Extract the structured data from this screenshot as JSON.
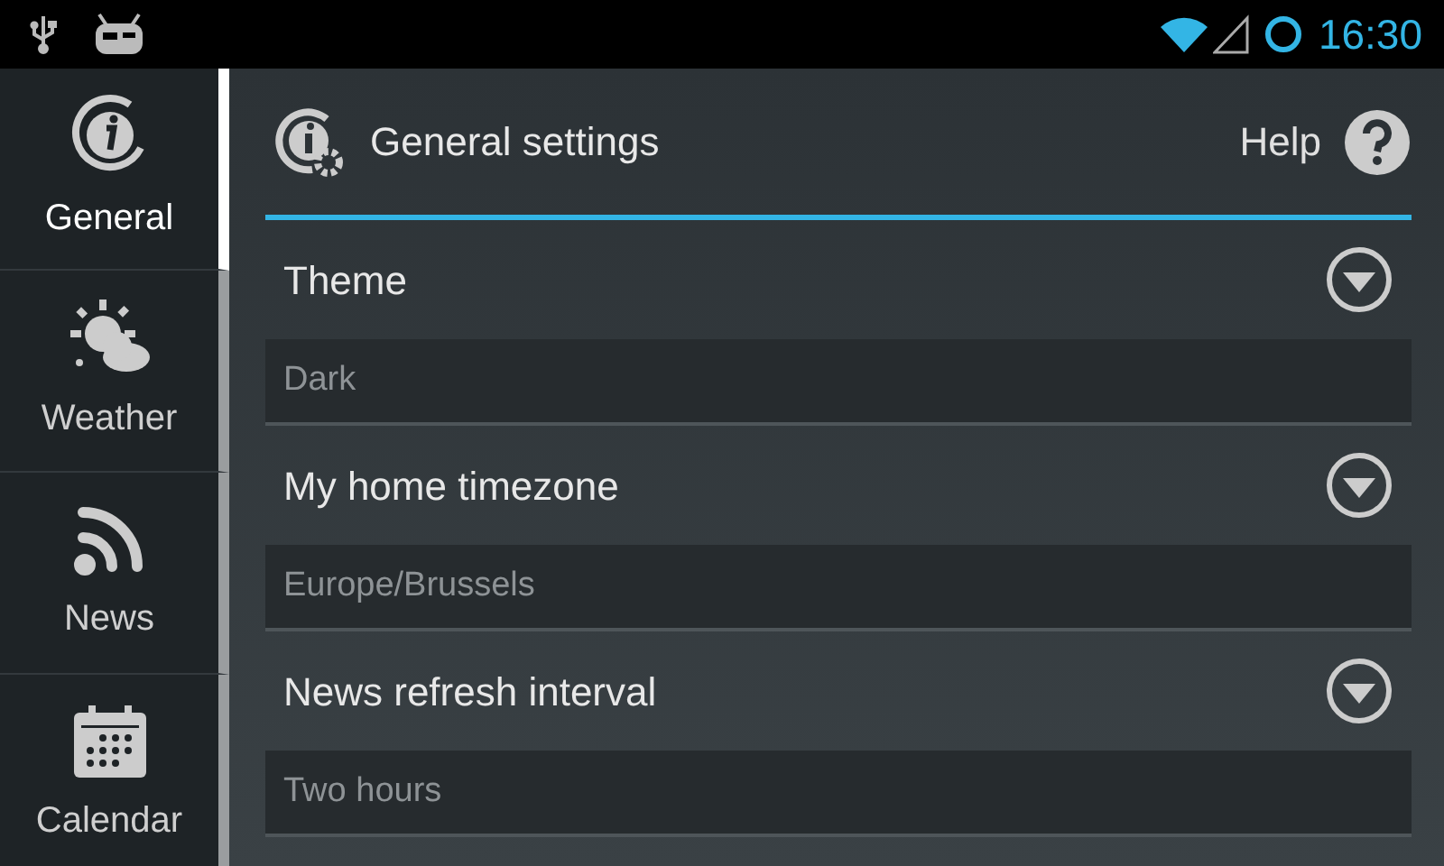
{
  "status_bar": {
    "time": "16:30"
  },
  "sidebar": {
    "items": [
      {
        "kind": "info",
        "label": "General",
        "selected": true
      },
      {
        "kind": "weather",
        "label": "Weather",
        "selected": false
      },
      {
        "kind": "news",
        "label": "News",
        "selected": false
      },
      {
        "kind": "calendar",
        "label": "Calendar",
        "selected": false
      }
    ]
  },
  "header": {
    "title": "General settings",
    "help": "Help"
  },
  "settings": [
    {
      "label": "Theme",
      "value": "Dark"
    },
    {
      "label": "My home timezone",
      "value": "Europe/Brussels"
    },
    {
      "label": "News refresh interval",
      "value": "Two hours"
    }
  ]
}
